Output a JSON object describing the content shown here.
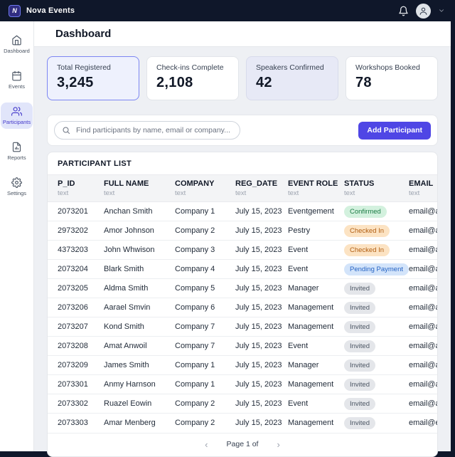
{
  "topbar": {
    "brand": "Nova Events",
    "logo_letter": "N"
  },
  "sidebar": {
    "items": [
      {
        "id": "dashboard",
        "label": "Dashboard",
        "icon": "home",
        "active": false
      },
      {
        "id": "events",
        "label": "Events",
        "icon": "calendar",
        "active": false
      },
      {
        "id": "participants",
        "label": "Participants",
        "icon": "users",
        "active": true
      },
      {
        "id": "reports",
        "label": "Reports",
        "icon": "report",
        "active": false
      },
      {
        "id": "settings",
        "label": "Settings",
        "icon": "gear",
        "active": false
      }
    ]
  },
  "page": {
    "title": "Dashboard"
  },
  "stats": [
    {
      "label": "Total Registered",
      "value": "3,245",
      "style": "primary"
    },
    {
      "label": "Check-ins Complete",
      "value": "2,108",
      "style": "plain"
    },
    {
      "label": "Speakers Confirmed",
      "value": "42",
      "style": "soft"
    },
    {
      "label": "Workshops Booked",
      "value": "78",
      "style": "plain"
    }
  ],
  "toolbar": {
    "search_placeholder": "Find participants by name, email or company...",
    "add_button": "Add Participant"
  },
  "table": {
    "title": "PARTICIPANT LIST",
    "columns": [
      {
        "name": "P_ID",
        "type": "text"
      },
      {
        "name": "FULL NAME",
        "type": "text"
      },
      {
        "name": "COMPANY",
        "type": "text"
      },
      {
        "name": "REG_DATE",
        "type": "text"
      },
      {
        "name": "EVENT ROLE",
        "type": "text"
      },
      {
        "name": "STATUS",
        "type": "text"
      },
      {
        "name": "EMAIL",
        "type": "text"
      }
    ],
    "rows": [
      {
        "id": "2073201",
        "name": "Anchan Smith",
        "company": "Company 1",
        "date": "July 15, 2023",
        "role": "Eventgement",
        "status": "Confirmed",
        "status_type": "confirmed",
        "email": "email@annoa"
      },
      {
        "id": "2973202",
        "name": "Amor Johnson",
        "company": "Company 2",
        "date": "July 15, 2023",
        "role": "Pestry",
        "status": "Checked In",
        "status_type": "checked",
        "email": "email@annor"
      },
      {
        "id": "4373203",
        "name": "John Whwison",
        "company": "Company 3",
        "date": "July 15, 2023",
        "role": "Event",
        "status": "Checked In",
        "status_type": "checked",
        "email": "email@annor"
      },
      {
        "id": "2073204",
        "name": "Blark Smith",
        "company": "Company 4",
        "date": "July 15, 2023",
        "role": "Event",
        "status": "Pending Payment",
        "status_type": "pending",
        "email": "email@annor"
      },
      {
        "id": "2073205",
        "name": "Aldma Smith",
        "company": "Company 5",
        "date": "July 15, 2023",
        "role": "Manager",
        "status": "Invited",
        "status_type": "invited",
        "email": "email@amtnr"
      },
      {
        "id": "2073206",
        "name": "Aarael Smvin",
        "company": "Company 6",
        "date": "July 15, 2023",
        "role": "Management",
        "status": "Invited",
        "status_type": "invited",
        "email": "email@annoa"
      },
      {
        "id": "2073207",
        "name": "Kond Smith",
        "company": "Company 7",
        "date": "July 15, 2023",
        "role": "Management",
        "status": "Invited",
        "status_type": "invited",
        "email": "email@annor"
      },
      {
        "id": "2073208",
        "name": "Amat Anwoil",
        "company": "Company 7",
        "date": "July 15, 2023",
        "role": "Event",
        "status": "Invited",
        "status_type": "invited",
        "email": "email@amtni"
      },
      {
        "id": "2073209",
        "name": "James Smith",
        "company": "Company 1",
        "date": "July 15, 2023",
        "role": "Manager",
        "status": "Invited",
        "status_type": "invited",
        "email": "email@annoa"
      },
      {
        "id": "2073301",
        "name": "Anmy Harnson",
        "company": "Company 1",
        "date": "July 15, 2023",
        "role": "Management",
        "status": "Invited",
        "status_type": "invited",
        "email": "email@annor"
      },
      {
        "id": "2073302",
        "name": "Ruazel Eowin",
        "company": "Company 2",
        "date": "July 15, 2023",
        "role": "Event",
        "status": "Invited",
        "status_type": "invited",
        "email": "email@amma"
      },
      {
        "id": "2073303",
        "name": "Amar Menberg",
        "company": "Company 2",
        "date": "July 15, 2023",
        "role": "Management",
        "status": "Invited",
        "status_type": "invited",
        "email": "email@emma"
      }
    ]
  },
  "pagination": {
    "prev": "‹",
    "label": "Page 1 of",
    "next": "›"
  },
  "colors": {
    "accent": "#4f46e5",
    "topbar_bg": "#0f172a",
    "page_bg": "#eef0f4",
    "status": {
      "confirmed": {
        "bg": "#d3f1de",
        "text": "#1c7c45"
      },
      "checked": {
        "bg": "#fce3c3",
        "text": "#b15e12"
      },
      "pending": {
        "bg": "#d3e4fa",
        "text": "#2563c4"
      },
      "invited": {
        "bg": "#e4e6ea",
        "text": "#4b5563"
      }
    }
  }
}
